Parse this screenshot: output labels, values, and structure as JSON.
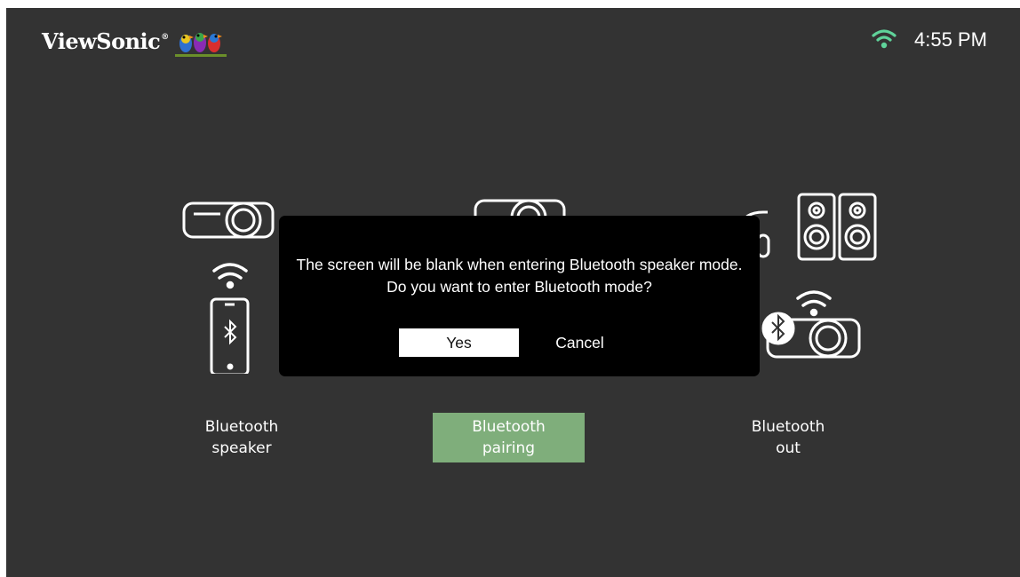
{
  "header": {
    "brand": "ViewSonic",
    "brand_mark": "®",
    "time": "4:55 PM",
    "wifi_icon": "wifi-icon",
    "logo_icon": "birds-logo-icon"
  },
  "modes": [
    {
      "line1": "Bluetooth",
      "line2": "speaker",
      "selected": false
    },
    {
      "line1": "Bluetooth",
      "line2": "pairing",
      "selected": true
    },
    {
      "line1": "Bluetooth",
      "line2": "out",
      "selected": false
    }
  ],
  "dialog": {
    "line1": "The screen will be blank when entering Bluetooth speaker mode.",
    "line2": "Do you want to enter Bluetooth mode?",
    "yes_label": "Yes",
    "cancel_label": "Cancel"
  },
  "colors": {
    "background": "#333333",
    "selected_tile": "#7fae7b",
    "wifi_accent": "#5fd39a",
    "dialog_bg": "#000000"
  }
}
